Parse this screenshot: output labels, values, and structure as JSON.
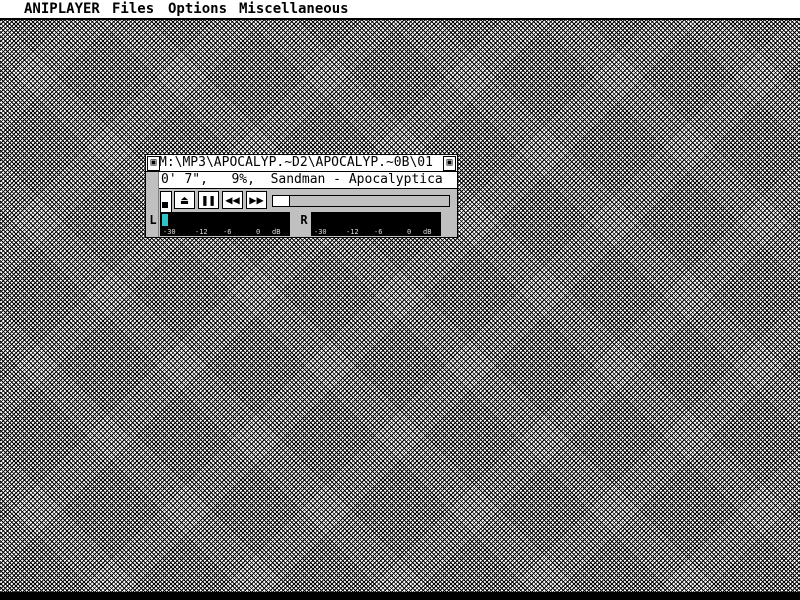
{
  "menu": {
    "items": [
      "ANIPLAYER",
      "Files",
      "Options",
      "Miscellaneous"
    ]
  },
  "player": {
    "title": "M:\\MP3\\APOCALYP.~D2\\APOCALYP.~0B\\01",
    "close_glyph": "▣",
    "full_glyph": "▣",
    "info": "0' 7\",   9%,  Sandman - Apocalyptica",
    "progress_percent": 9,
    "controls": {
      "eject": "⏏",
      "pause": "❚❚",
      "rewind": "◀◀",
      "fast_forward": "▶▶"
    },
    "vu": {
      "left_label": "L",
      "right_label": "R",
      "left_level": 0.05,
      "right_level": 0.0,
      "scale": [
        "-30",
        "-12",
        "-6",
        "0",
        "dB"
      ],
      "color": "#2ec4c4"
    }
  },
  "colors": {
    "desktop_pattern": "#000000",
    "window_bg": "#c0c0c0"
  }
}
